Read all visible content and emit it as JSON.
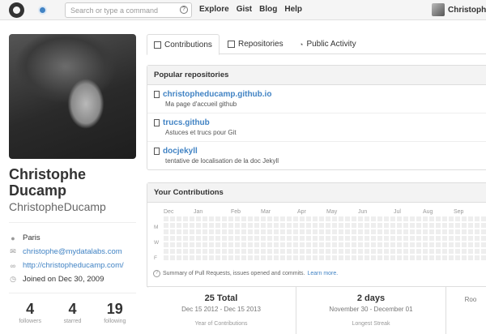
{
  "header": {
    "search_placeholder": "Search or type a command",
    "help_glyph": "?",
    "nav": [
      "Explore",
      "Gist",
      "Blog",
      "Help"
    ],
    "user": "Christophe"
  },
  "profile": {
    "name": "Christophe Ducamp",
    "username": "ChristopheDucamp",
    "location": "Paris",
    "email": "christophe@mydatalabs.com",
    "website": "http://christopheducamp.com/",
    "joined": "Joined on Dec 30, 2009",
    "stats": [
      {
        "value": "4",
        "label": "followers"
      },
      {
        "value": "4",
        "label": "starred"
      },
      {
        "value": "19",
        "label": "following"
      }
    ]
  },
  "tabs": [
    {
      "label": "Contributions",
      "icon": "contributions-icon"
    },
    {
      "label": "Repositories",
      "icon": "repo-icon"
    },
    {
      "label": "Public Activity",
      "icon": "rss-icon"
    }
  ],
  "popular": {
    "title": "Popular repositories",
    "repos": [
      {
        "name": "christopheducamp.github.io",
        "desc": "Ma page d'accueil github",
        "icon": "repo-icon"
      },
      {
        "name": "trucs.github",
        "desc": "Astuces et trucs pour Git",
        "icon": "fork-icon"
      },
      {
        "name": "docjekyll",
        "desc": "tentative de localisation de la doc Jekyll",
        "icon": "repo-icon"
      }
    ]
  },
  "contributions": {
    "title": "Your Contributions",
    "months": [
      "Dec",
      "Jan",
      "Feb",
      "Mar",
      "Apr",
      "May",
      "Jun",
      "Jul",
      "Aug",
      "Sep"
    ],
    "days": [
      "M",
      "W",
      "F"
    ],
    "footer_text": "Summary of Pull Requests, issues opened and commits.",
    "footer_link": "Learn more.",
    "summary": [
      {
        "big": "25 Total",
        "small": "Dec 15 2012 - Dec 15 2013",
        "cut": "Year of Contributions"
      },
      {
        "big": "2 days",
        "small": "November 30 - December 01",
        "cut": "Longest Streak"
      },
      {
        "big": "",
        "small": "Roo",
        "cut": ""
      }
    ]
  }
}
